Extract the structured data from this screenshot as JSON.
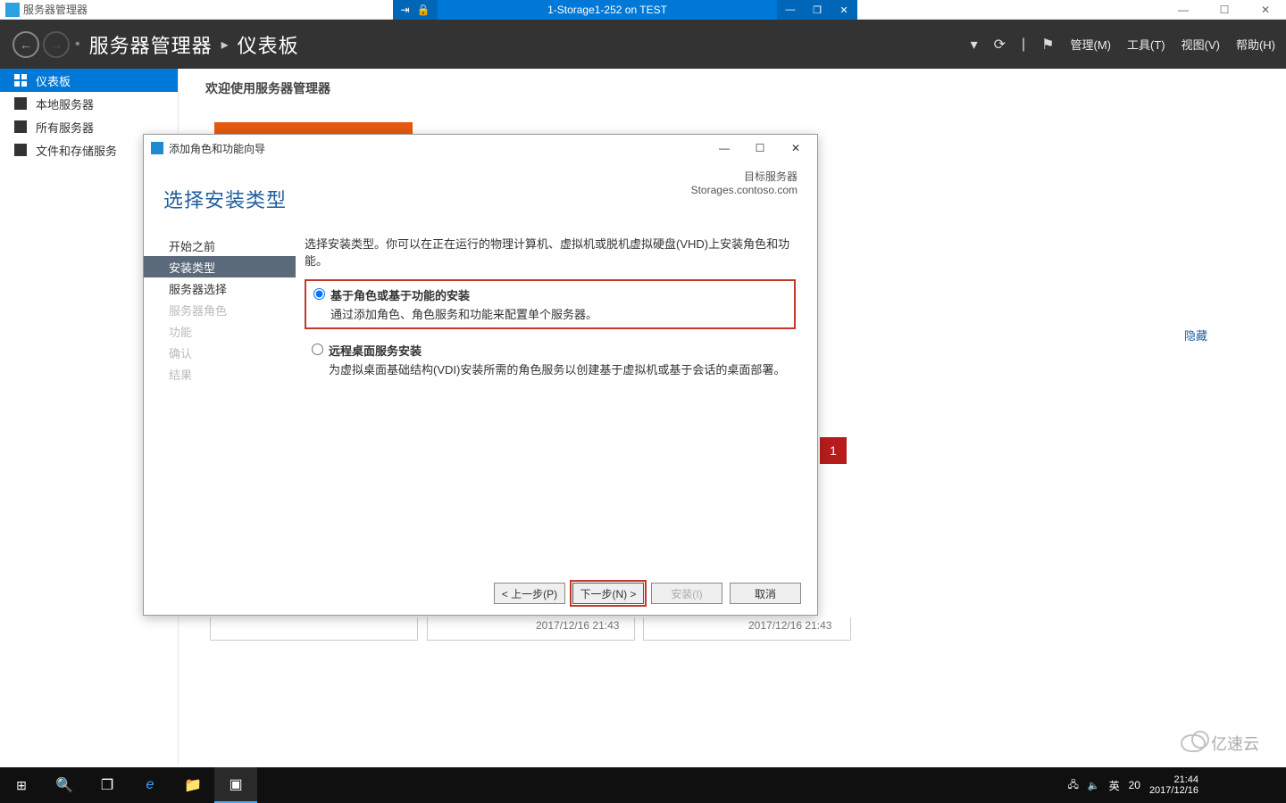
{
  "host_window": {
    "app_title": "服务器管理器",
    "rdp_title": "1-Storage1-252 on TEST",
    "rdp_pin": "⇥",
    "rdp_lock": "🔒",
    "rdp_min": "—",
    "rdp_max": "❐",
    "rdp_close": "✕",
    "ctrl_min": "—",
    "ctrl_max": "☐",
    "ctrl_close": "✕"
  },
  "header": {
    "back": "←",
    "forward": "→",
    "bullet": "•",
    "title": "服务器管理器",
    "caret": "▸",
    "subtitle": "仪表板",
    "refresh": "⟳",
    "sep": "|",
    "flag": "⚑",
    "menus": {
      "manage": "管理(M)",
      "tools": "工具(T)",
      "view": "视图(V)",
      "help": "帮助(H)"
    },
    "dropdown": "▾"
  },
  "sidebar": {
    "items": [
      {
        "label": "仪表板"
      },
      {
        "label": "本地服务器"
      },
      {
        "label": "所有服务器"
      },
      {
        "label": "文件和存储服务"
      }
    ]
  },
  "main": {
    "welcome": "欢迎使用服务器管理器",
    "hide": "隐藏",
    "badge": "1",
    "ts_a": "2017/12/16 21:43",
    "ts_b": "2017/12/16 21:43"
  },
  "wizard": {
    "window_title": "添加角色和功能向导",
    "win_min": "—",
    "win_max": "☐",
    "win_close": "✕",
    "heading": "选择安装类型",
    "target_label": "目标服务器",
    "target_server": "Storages.contoso.com",
    "nav": [
      {
        "label": "开始之前"
      },
      {
        "label": "安装类型"
      },
      {
        "label": "服务器选择"
      },
      {
        "label": "服务器角色"
      },
      {
        "label": "功能"
      },
      {
        "label": "确认"
      },
      {
        "label": "结果"
      }
    ],
    "intro": "选择安装类型。你可以在正在运行的物理计算机、虚拟机或脱机虚拟硬盘(VHD)上安装角色和功能。",
    "opt1_title": "基于角色或基于功能的安装",
    "opt1_desc": "通过添加角色、角色服务和功能来配置单个服务器。",
    "opt2_title": "远程桌面服务安装",
    "opt2_desc": "为虚拟桌面基础结构(VDI)安装所需的角色服务以创建基于虚拟机或基于会话的桌面部署。",
    "buttons": {
      "prev": "< 上一步(P)",
      "next": "下一步(N) >",
      "install": "安装(I)",
      "cancel": "取消"
    }
  },
  "taskbar": {
    "start": "⊞",
    "search": "🔍",
    "taskview": "❐",
    "ie": "e",
    "explorer": "📁",
    "sm": "▣",
    "tray_net": "🖧",
    "tray_vol": "🔈",
    "ime": "英",
    "ime2": "20",
    "clock1": "21:44",
    "clock2": "2017/12/16"
  },
  "watermark": {
    "text": "亿速云"
  }
}
